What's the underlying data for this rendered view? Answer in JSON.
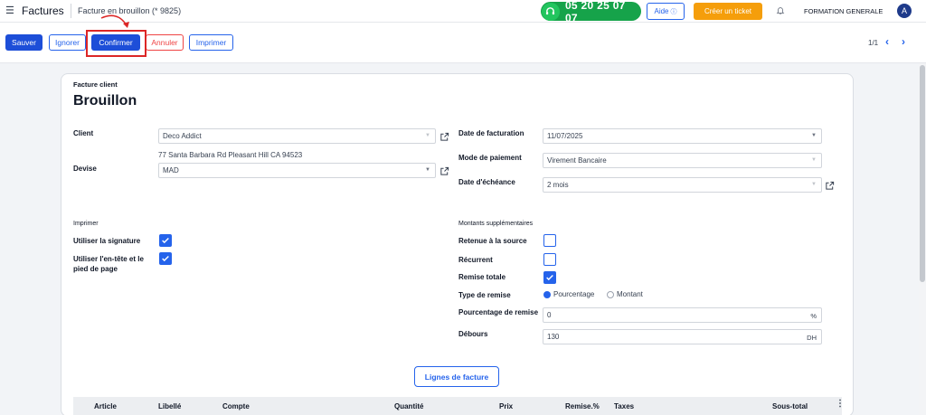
{
  "nav": {
    "menu_icon": "hamburger-icon",
    "app_title": "Factures",
    "breadcrumb": "Facture en brouillon (* 9825)",
    "phone": "05 20 25 07 07",
    "aide": "Aide",
    "ticket": "Créer un ticket",
    "company": "FORMATION GENERALE",
    "avatar_letter": "A"
  },
  "toolbar": {
    "save": "Sauver",
    "ignore": "Ignorer",
    "confirm": "Confirmer",
    "cancel": "Annuler",
    "print": "Imprimer",
    "pager": "1/1"
  },
  "form": {
    "subtitle": "Facture client",
    "title": "Brouillon",
    "left": {
      "client_label": "Client",
      "client_value": "Deco Addict",
      "client_address": "77 Santa Barbara Rd Pleasant Hill CA 94523",
      "currency_label": "Devise",
      "currency_value": "MAD"
    },
    "right": {
      "invoice_date_label": "Date de facturation",
      "invoice_date_value": "11/07/2025",
      "payment_mode_label": "Mode de paiement",
      "payment_mode_value": "Virement Bancaire",
      "due_date_label": "Date d'échéance",
      "due_date_value": "2 mois"
    },
    "print_section": {
      "heading": "Imprimer",
      "signature_label": "Utiliser la signature",
      "signature_checked": true,
      "header_footer_label": "Utiliser l'en-tête et le pied de page",
      "header_footer_checked": true
    },
    "extra_section": {
      "heading": "Montants supplémentaires",
      "withholding_label": "Retenue à la source",
      "withholding_checked": false,
      "recurring_label": "Récurrent",
      "recurring_checked": false,
      "total_discount_label": "Remise totale",
      "total_discount_checked": true,
      "discount_type_label": "Type de remise",
      "discount_type_options": [
        "Pourcentage",
        "Montant"
      ],
      "discount_type_selected": "Pourcentage",
      "discount_percent_label": "Pourcentage de remise",
      "discount_percent_value": "0",
      "discount_percent_suffix": "%",
      "disbursement_label": "Débours",
      "disbursement_value": "130",
      "disbursement_suffix": "DH"
    },
    "lines_button": "Lignes de facture",
    "table_headers": [
      "Article",
      "Libellé",
      "Compte",
      "Quantité",
      "Prix",
      "Remise.%",
      "Taxes",
      "Sous-total"
    ]
  },
  "colors": {
    "primary": "#1d4ed8",
    "danger": "#ef4444",
    "phone_green": "#16a34a",
    "ticket_orange": "#f59e0b",
    "annotation_red": "#dc2626"
  }
}
